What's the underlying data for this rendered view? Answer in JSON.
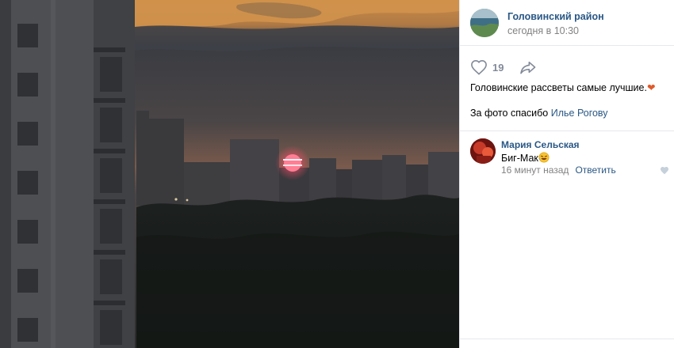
{
  "post": {
    "group_name": "Головинский район",
    "time": "сегодня в 10:30",
    "likes": "19",
    "text": "Головинские рассветы самые лучшие.",
    "text_emoji": "❤",
    "thanks_prefix": "За фото спасибо ",
    "thanks_link": "Илье Рогову"
  },
  "comments": [
    {
      "author": "Мария Сельская",
      "text": "Биг-Мак",
      "time": "16 минут назад",
      "reply_label": "Ответить"
    }
  ],
  "icons": {
    "like": "heart-outline-icon",
    "share": "share-arrow-icon",
    "comment_like": "heart-filled-icon"
  },
  "colors": {
    "link": "#2a5885",
    "muted": "#828282",
    "icon": "#828a99",
    "divider": "#e7e8ec",
    "heart_emoji": "#e05a2b"
  }
}
